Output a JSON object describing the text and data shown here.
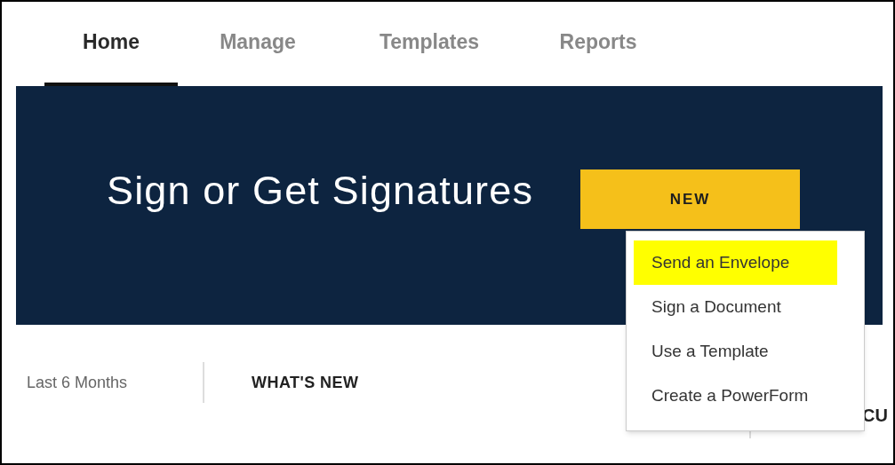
{
  "tabs": [
    {
      "label": "Home",
      "selected": true
    },
    {
      "label": "Manage",
      "selected": false
    },
    {
      "label": "Templates",
      "selected": false
    },
    {
      "label": "Reports",
      "selected": false
    }
  ],
  "banner": {
    "title": "Sign or Get Signatures",
    "new_button": "NEW"
  },
  "new_menu": {
    "items": [
      {
        "label": "Send an Envelope",
        "highlighted": true
      },
      {
        "label": "Sign a Document",
        "highlighted": false
      },
      {
        "label": "Use a Template",
        "highlighted": false
      },
      {
        "label": "Create a PowerForm",
        "highlighted": false
      }
    ]
  },
  "filter": "Last 6 Months",
  "section_heading": "WHAT'S NEW",
  "column_3": "CU"
}
